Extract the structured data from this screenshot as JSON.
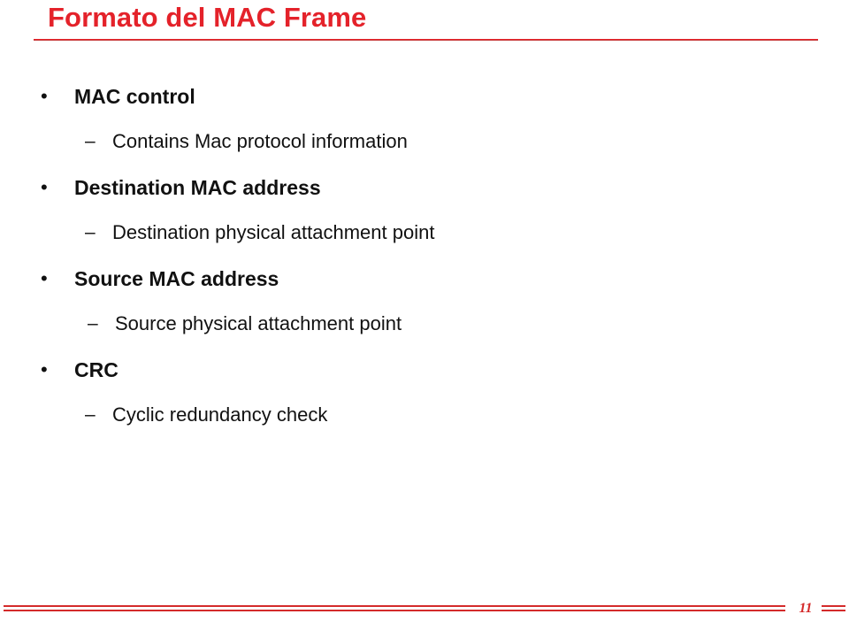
{
  "slide": {
    "title": "Formato del MAC Frame",
    "title_color": "#e4222a",
    "rule_color": "#e4222a",
    "background_color": "#ffffff",
    "body_text_color": "#111111",
    "level1_marker": "•",
    "level2_marker": "–",
    "bullets": [
      {
        "heading": "MAC control",
        "sub": "Contains Mac protocol information"
      },
      {
        "heading": "Destination MAC address",
        "sub": "Destination physical attachment point"
      },
      {
        "heading": "Source MAC address",
        "sub": "Source physical attachment point"
      },
      {
        "heading": "CRC",
        "sub": "Cyclic redundancy check"
      }
    ]
  },
  "footer": {
    "page_number": "11",
    "line_color": "#d42b2b"
  }
}
